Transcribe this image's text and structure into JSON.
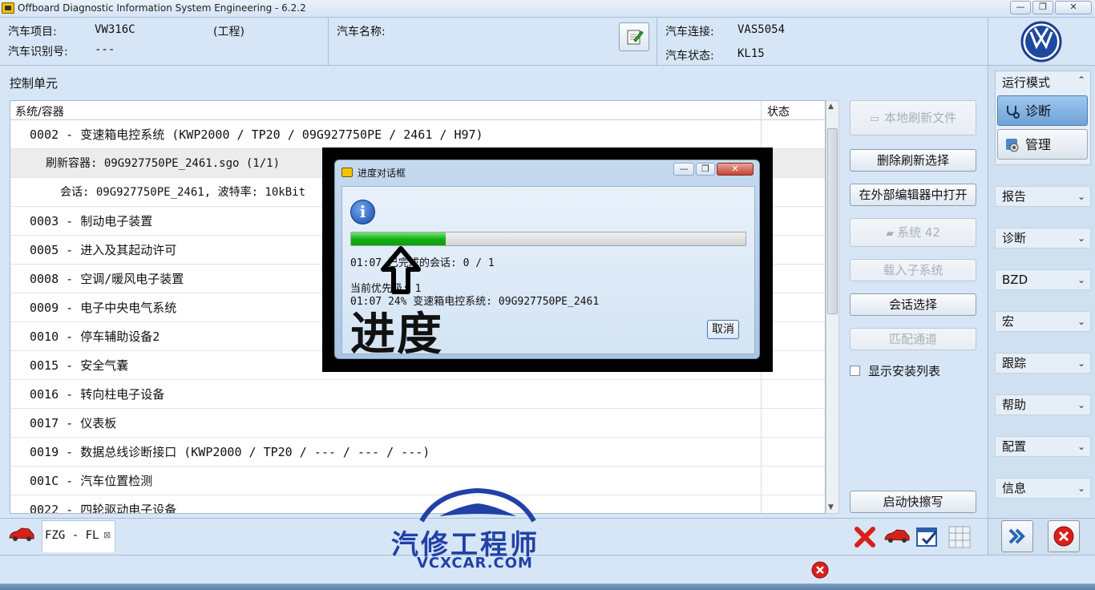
{
  "window": {
    "title": "Offboard Diagnostic Information System Engineering - 6.2.2",
    "controls": [
      "—",
      "❐",
      "✕"
    ]
  },
  "header": {
    "vehicle_project_label": "汽车项目:",
    "vehicle_project_value": "VW316C",
    "vehicle_project_mode": "(工程)",
    "vin_label": "汽车识别号:",
    "vin_value": "---",
    "vehicle_name_label": "汽车名称:",
    "connection_label": "汽车连接:",
    "connection_value": "VAS5054",
    "state_label": "汽车状态:",
    "state_value": "KL15"
  },
  "main": {
    "section_label": "控制单元",
    "columns": {
      "system": "系统/容器",
      "status": "状态"
    },
    "rows": [
      {
        "text": "0002 - 变速箱电控系统  (KWP2000 / TP20 / 09G927750PE / 2461 / H97)",
        "level": 0
      },
      {
        "text": "刷新容器: 09G927750PE_2461.sgo (1/1)",
        "level": 1
      },
      {
        "text": "会话: 09G927750PE_2461, 波特率: 10kBit",
        "level": 2
      },
      {
        "text": "0003 - 制动电子装置",
        "level": 0
      },
      {
        "text": "0005 - 进入及其起动许可",
        "level": 0
      },
      {
        "text": "0008 - 空调/暖风电子装置",
        "level": 0
      },
      {
        "text": "0009 - 电子中央电气系统",
        "level": 0
      },
      {
        "text": "0010 - 停车辅助设备2",
        "level": 0
      },
      {
        "text": "0015 - 安全气囊",
        "level": 0
      },
      {
        "text": "0016 - 转向柱电子设备",
        "level": 0
      },
      {
        "text": "0017 - 仪表板",
        "level": 0
      },
      {
        "text": "0019 - 数据总线诊断接口  (KWP2000 / TP20 / --- / --- / ---)",
        "level": 0
      },
      {
        "text": "001C - 汽车位置检测",
        "level": 0
      },
      {
        "text": "0022 - 四轮驱动电子设备",
        "level": 0
      }
    ]
  },
  "actions": {
    "local_flash_file": "本地刷新文件",
    "delete_flash_selection": "删除刷新选择",
    "open_in_external_editor": "在外部编辑器中打开",
    "system_42": "系统 42",
    "load_subsystem": "载入子系统",
    "session_select": "会话选择",
    "match_channel": "匹配通道",
    "show_install_list": "显示安装列表",
    "start_quick_erase": "启动快擦写"
  },
  "sidebar": {
    "mode_title": "运行模式",
    "modes": [
      "诊断",
      "管理"
    ],
    "items": [
      "报告",
      "诊断",
      "BZD",
      "宏",
      "跟踪",
      "帮助",
      "配置",
      "信息"
    ]
  },
  "tabs": {
    "active_tab": "FZG - FL",
    "close_glyph": "⊠"
  },
  "dialog": {
    "title": "进度对话框",
    "info_glyph": "i",
    "progress_fraction": 0.24,
    "line1": "01:07  已完成的会话:  0 / 1",
    "line2": "当前优先级:  1",
    "line3": "01:07  24%  变速箱电控系统: 09G927750PE_2461",
    "cancel_label": "取消",
    "overlay_caption": "进度"
  },
  "watermark": {
    "name": "汽修工程师",
    "url": "VCXCAR.COM"
  },
  "colors": {
    "accent_blue": "#2240a6",
    "progress_green": "#15b215",
    "error_red": "#d8201a"
  }
}
